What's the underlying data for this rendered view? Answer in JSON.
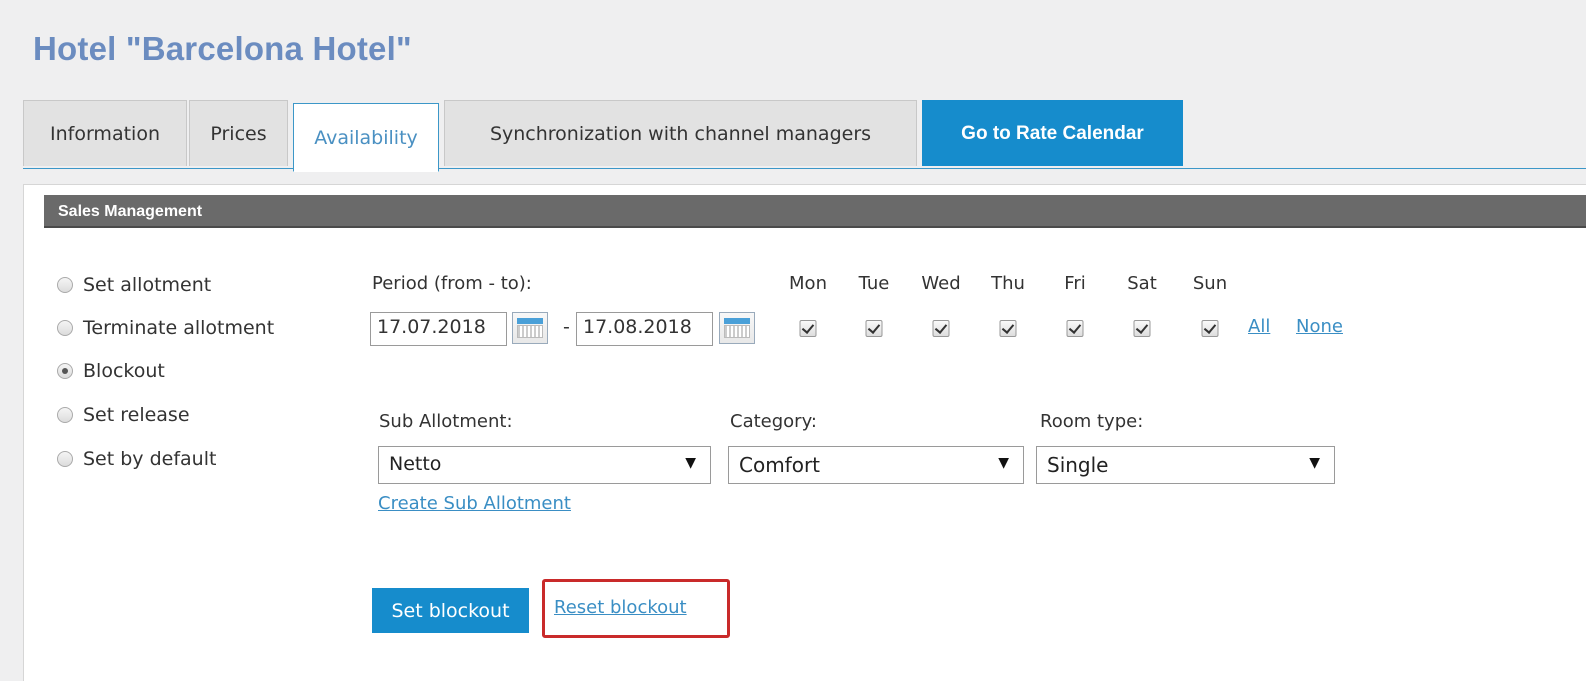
{
  "page": {
    "title": "Hotel \"Barcelona Hotel\""
  },
  "tabs": [
    {
      "label": "Information"
    },
    {
      "label": "Prices"
    },
    {
      "label": "Availability",
      "active": true
    },
    {
      "label": "Synchronization with channel managers"
    },
    {
      "label": "Go to Rate Calendar"
    }
  ],
  "panel": {
    "header": "Sales Management"
  },
  "actions": [
    {
      "label": "Set allotment",
      "checked": false
    },
    {
      "label": "Terminate allotment",
      "checked": false
    },
    {
      "label": "Blockout",
      "checked": true
    },
    {
      "label": "Set release",
      "checked": false
    },
    {
      "label": "Set by default",
      "checked": false
    }
  ],
  "period": {
    "label": "Period (from - to):",
    "from": "17.07.2018",
    "separator": "-",
    "to": "17.08.2018"
  },
  "days": [
    {
      "label": "Mon",
      "checked": true
    },
    {
      "label": "Tue",
      "checked": true
    },
    {
      "label": "Wed",
      "checked": true
    },
    {
      "label": "Thu",
      "checked": true
    },
    {
      "label": "Fri",
      "checked": true
    },
    {
      "label": "Sat",
      "checked": true
    },
    {
      "label": "Sun",
      "checked": true
    }
  ],
  "day_links": {
    "all": "All",
    "none": "None"
  },
  "sub_allotment": {
    "label": "Sub Allotment:",
    "value": "Netto",
    "create_link": "Create Sub Allotment"
  },
  "category": {
    "label": "Category:",
    "value": "Comfort"
  },
  "room_type": {
    "label": "Room type:",
    "value": "Single"
  },
  "buttons": {
    "set_blockout": "Set blockout",
    "reset_blockout": "Reset blockout"
  },
  "colors": {
    "accent": "#168ccc",
    "title": "#6b8cc0",
    "header_bg": "#6a6a6a",
    "highlight": "#c92a2a",
    "link": "#3a8ec4"
  },
  "icons": {
    "calendar": "calendar-icon",
    "dropdown": "chevron-down-icon"
  }
}
